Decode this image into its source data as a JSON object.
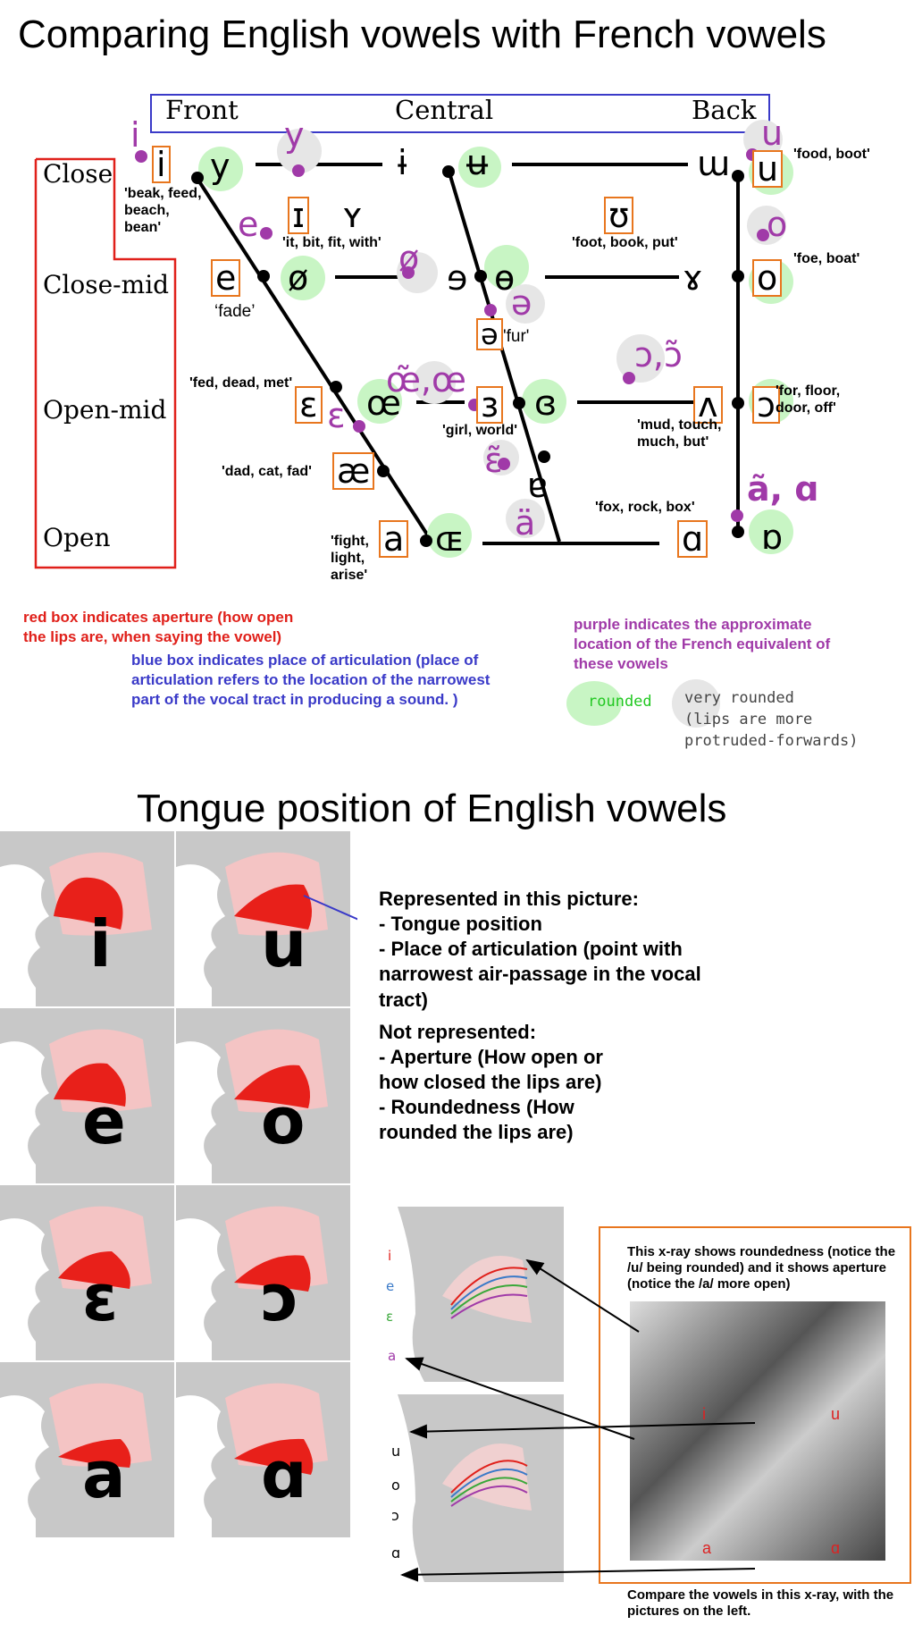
{
  "title": "Comparing English vowels with French vowels",
  "positions": {
    "front": "Front",
    "central": "Central",
    "back": "Back"
  },
  "apertures": {
    "close": "Close",
    "close_mid": "Close-mid",
    "open_mid": "Open-mid",
    "open": "Open"
  },
  "vowels": {
    "i": "i",
    "y": "y",
    "barred_i": "ɨ",
    "barred_u": "ʉ",
    "turned_m": "ɯ",
    "u": "u",
    "cap_i": "ɪ",
    "cap_y": "ʏ",
    "upsilon": "ʊ",
    "e": "e",
    "o_slash": "ø",
    "rev_e": "ɘ",
    "barred_o": "ɵ",
    "rams_horn": "ɤ",
    "o": "o",
    "schwa": "ə",
    "epsilon": "ɛ",
    "oe": "œ",
    "rev_epsilon": "ɜ",
    "closed_rev_epsilon": "ɞ",
    "turned_v": "ʌ",
    "open_o": "ɔ",
    "ae": "æ",
    "turned_a": "ɐ",
    "a": "a",
    "cap_oe": "ɶ",
    "script_a": "ɑ",
    "turned_script_a": "ɒ"
  },
  "french": {
    "i": "i",
    "y": "y",
    "e": "e",
    "o_slash": "ø",
    "u": "u",
    "o": "o",
    "schwa": "ə",
    "oe_nasal": "œ̃,œ",
    "epsilon": "ɛ",
    "epsilon_nasal": "ɛ̃",
    "open_o_nasal": "ɔ,ɔ̃",
    "a_uml": "ä",
    "a_nasal": "ã, ɑ"
  },
  "examples": {
    "i": "'beak, feed, beach, bean'",
    "cap_i": "'it, bit, fit, with'",
    "upsilon": "'foot, book, put'",
    "u": "'food, boot'",
    "o": "'foe, boat'",
    "e": "‘fade’",
    "schwa": "'fur'",
    "epsilon": "'fed, dead, met'",
    "rev_epsilon": "'girl, world'",
    "turned_v": "'mud, touch, much, but'",
    "open_o": "'for, floor, door, off'",
    "ae": "'dad, cat, fad'",
    "script_a": "'fox, rock, box'",
    "a": "'fight, light, arise'"
  },
  "notes": {
    "red": "red box indicates aperture (how open the lips are, when saying the vowel)",
    "blue": "blue box indicates place of articulation (place of articulation refers to the location of the narrowest part of the vocal tract in producing a sound. )",
    "purple": "purple indicates the approximate location of the French equivalent of these vowels",
    "rounded": "rounded",
    "very_rounded": "very rounded\n(lips are more\nprotruded-forwards)"
  },
  "title2": "Tongue position of English vowels",
  "tongue_letters": [
    "i",
    "u",
    "e",
    "o",
    "ɛ",
    "ɔ",
    "a",
    "ɑ"
  ],
  "represented": {
    "h1": "Represented in this picture:",
    "l1": " - Tongue position",
    "l2": " - Place of articulation (point with narrowest air-passage in the vocal tract)",
    "h2": "Not represented:",
    "l3": "- Aperture (How open or how closed the lips are)",
    "l4": "- Roundedness (How rounded the lips are)"
  },
  "diagram_labels": {
    "top": [
      "i",
      "e",
      "ɛ",
      "a"
    ],
    "bottom": [
      "u",
      "o",
      "ɔ",
      "ɑ"
    ]
  },
  "xray": {
    "caption": "This x-ray shows roundedness (notice the /u/ being rounded) and it shows aperture (notice the /a/ more open)",
    "labels": [
      "i",
      "u",
      "a",
      "ɑ"
    ],
    "footer": "Compare the vowels in this x-ray, with the pictures on the left."
  },
  "colors": {
    "green": "#c8f5c4",
    "grey": "#e6e6e6",
    "purple": "#a03aa8",
    "orange": "#e8761e",
    "red": "#e0201a",
    "blue": "#3a3ac8"
  }
}
